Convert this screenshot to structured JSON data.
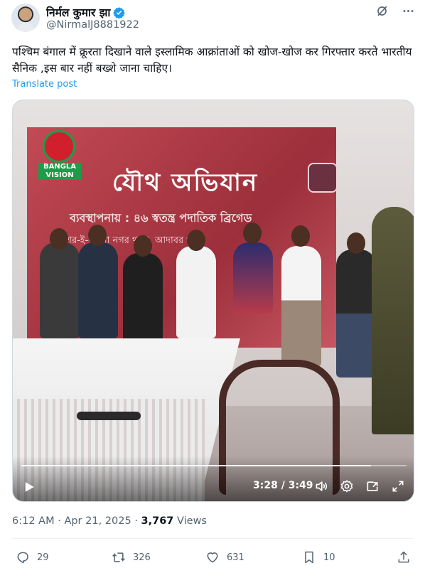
{
  "author": {
    "display_name": "निर्मल कुमार झा",
    "handle": "@NirmalJ8881922",
    "verified": true
  },
  "tweet": {
    "text": "पश्चिम बंगाल में क्रूरता दिखाने वाले इस्लामिक आक्रांताओं को खोज-खोज कर गिरफ्तार करते भारतीय सैनिक ,इस बार नहीं बख्शे जाना चाहिए।",
    "translate_label": "Translate post"
  },
  "media": {
    "banner_title": "যৌথ অভিযান",
    "banner_subtitle": "ব্যবস্থাপনায় : ৪৬ স্বতন্ত্র পদাতিক ব্রিগেড",
    "banner_line3": "শের-ই-বাংলা নগর থানা, আদাবর থানা",
    "channel_logo_text": "BANGLA VISION",
    "video": {
      "current_time": "3:28",
      "duration": "3:49",
      "progress_fraction": 0.908
    }
  },
  "meta": {
    "time": "6:12 AM",
    "separator": "·",
    "date": "Apr 21, 2025",
    "views_count": "3,767",
    "views_label": "Views"
  },
  "actions": {
    "replies": "29",
    "reposts": "326",
    "likes": "631",
    "bookmarks": "10"
  },
  "colors": {
    "link": "#1d9bf0",
    "secondary_text": "#536471",
    "primary_text": "#0f1419",
    "verified": "#1d9bf0"
  },
  "icons": [
    "grok-icon",
    "more-icon",
    "verified-badge-icon",
    "play-icon",
    "volume-icon",
    "settings-icon",
    "pip-icon",
    "fullscreen-icon",
    "reply-icon",
    "repost-icon",
    "like-icon",
    "bookmark-icon",
    "share-icon"
  ]
}
